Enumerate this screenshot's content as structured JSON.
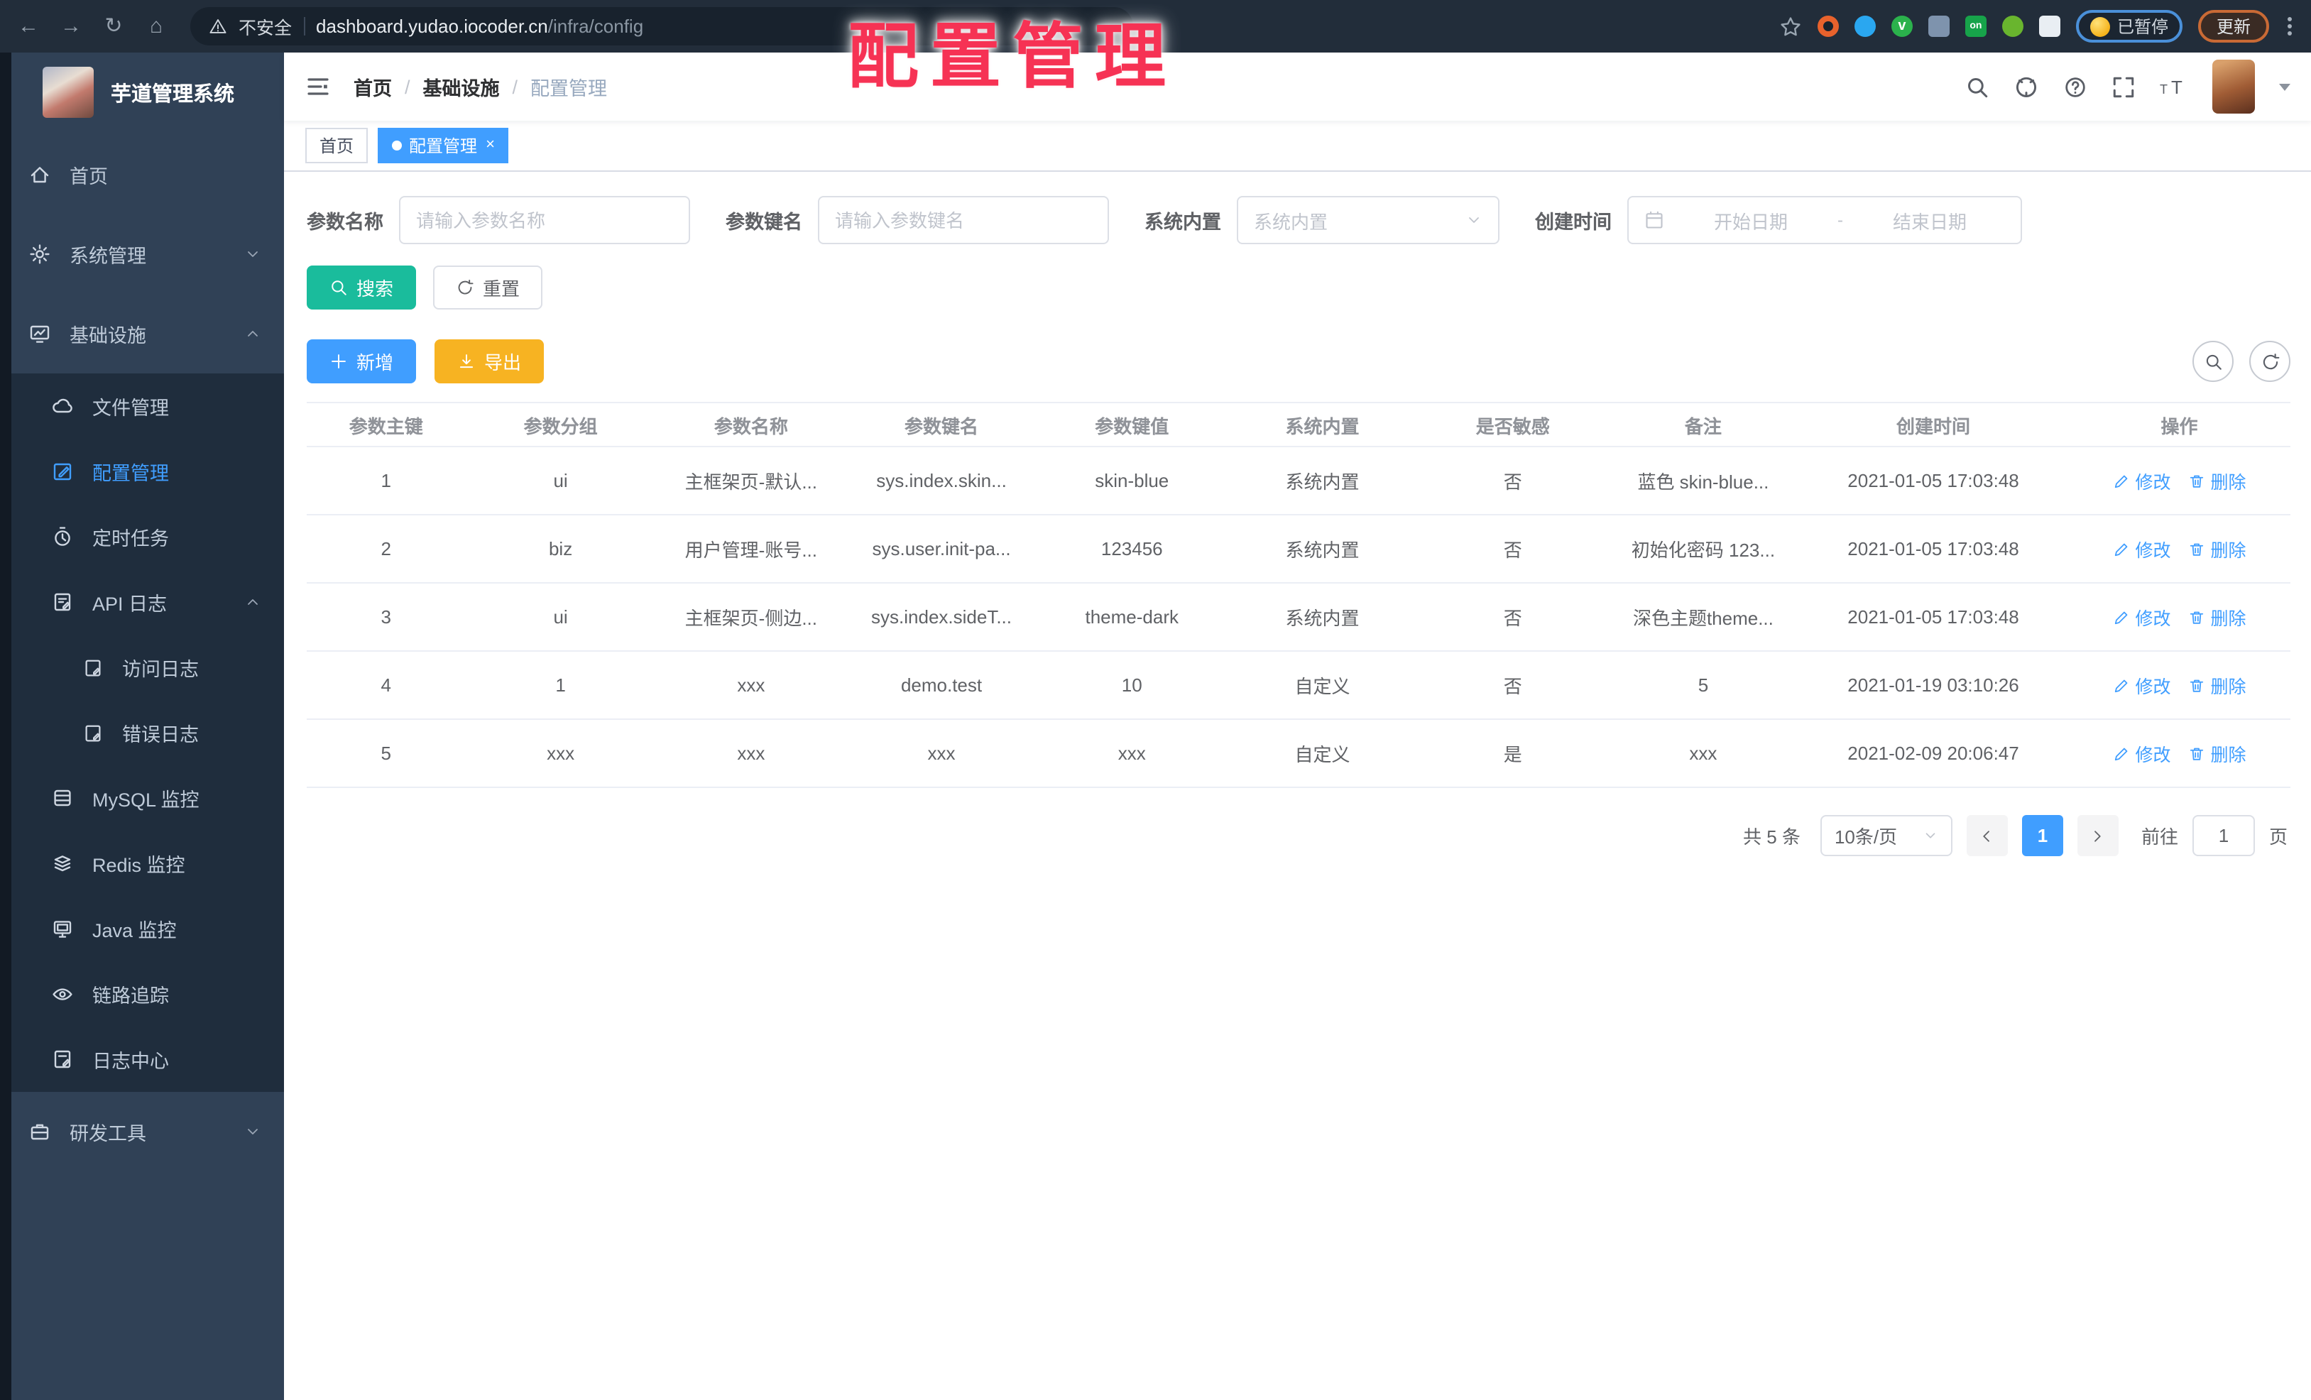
{
  "browser": {
    "security_label": "不安全",
    "url_domain": "dashboard.yudao.iocoder.cn",
    "url_path": "/infra/config",
    "paused_label": "已暂停",
    "update_label": "更新"
  },
  "watermark": "配置管理",
  "sidebar": {
    "title": "芋道管理系统",
    "items": [
      {
        "label": "首页"
      },
      {
        "label": "系统管理"
      },
      {
        "label": "基础设施"
      },
      {
        "label": "文件管理"
      },
      {
        "label": "配置管理"
      },
      {
        "label": "定时任务"
      },
      {
        "label": "API 日志"
      },
      {
        "label": "访问日志"
      },
      {
        "label": "错误日志"
      },
      {
        "label": "MySQL 监控"
      },
      {
        "label": "Redis 监控"
      },
      {
        "label": "Java 监控"
      },
      {
        "label": "链路追踪"
      },
      {
        "label": "日志中心"
      },
      {
        "label": "研发工具"
      }
    ]
  },
  "header": {
    "breadcrumb": [
      "首页",
      "基础设施",
      "配置管理"
    ],
    "separator": "/"
  },
  "tabs": [
    {
      "label": "首页"
    },
    {
      "label": "配置管理"
    }
  ],
  "filters": {
    "name_label": "参数名称",
    "name_placeholder": "请输入参数名称",
    "key_label": "参数键名",
    "key_placeholder": "请输入参数键名",
    "builtin_label": "系统内置",
    "builtin_placeholder": "系统内置",
    "created_label": "创建时间",
    "start_placeholder": "开始日期",
    "range_separator": "-",
    "end_placeholder": "结束日期"
  },
  "buttons": {
    "search": "搜索",
    "reset": "重置",
    "add": "新增",
    "export": "导出"
  },
  "table": {
    "columns": [
      "参数主键",
      "参数分组",
      "参数名称",
      "参数键名",
      "参数键值",
      "系统内置",
      "是否敏感",
      "备注",
      "创建时间",
      "操作"
    ],
    "rows": [
      {
        "cells": [
          "1",
          "ui",
          "主框架页-默认...",
          "sys.index.skin...",
          "skin-blue",
          "系统内置",
          "否",
          "蓝色 skin-blue...",
          "2021-01-05 17:03:48"
        ]
      },
      {
        "cells": [
          "2",
          "biz",
          "用户管理-账号...",
          "sys.user.init-pa...",
          "123456",
          "系统内置",
          "否",
          "初始化密码 123...",
          "2021-01-05 17:03:48"
        ]
      },
      {
        "cells": [
          "3",
          "ui",
          "主框架页-侧边...",
          "sys.index.sideT...",
          "theme-dark",
          "系统内置",
          "否",
          "深色主题theme...",
          "2021-01-05 17:03:48"
        ]
      },
      {
        "cells": [
          "4",
          "1",
          "xxx",
          "demo.test",
          "10",
          "自定义",
          "否",
          "5",
          "2021-01-19 03:10:26"
        ]
      },
      {
        "cells": [
          "5",
          "xxx",
          "xxx",
          "xxx",
          "xxx",
          "自定义",
          "是",
          "xxx",
          "2021-02-09 20:06:47"
        ]
      }
    ],
    "edit_label": "修改",
    "delete_label": "删除"
  },
  "pagination": {
    "total": "共 5 条",
    "page_size": "10条/页",
    "current_page": "1",
    "goto_label": "前往",
    "goto_value": "1",
    "unit_label": "页"
  },
  "colors": {
    "accent": "#409eff",
    "search_button": "#1abc9c",
    "export_button": "#f7b322",
    "watermark": "#f63254"
  }
}
